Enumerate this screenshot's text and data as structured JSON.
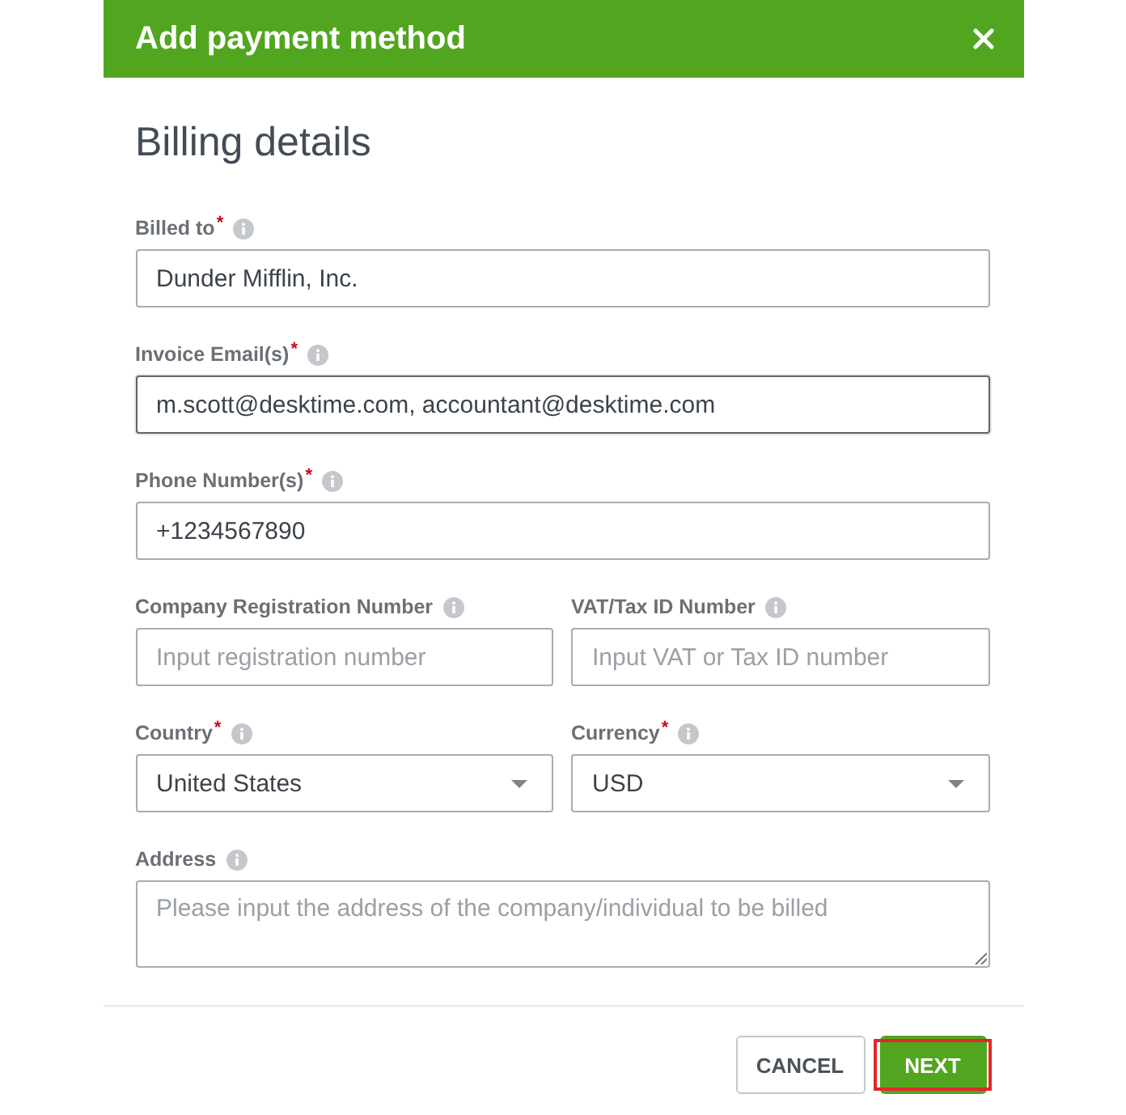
{
  "dialog": {
    "title": "Add payment method",
    "heading": "Billing details"
  },
  "rows": [
    {
      "fields": [
        {
          "kind": "text",
          "label": "Billed to",
          "required_mark": "*",
          "info": true,
          "value": "Dunder Mifflin, Inc.",
          "focused": false
        }
      ]
    },
    {
      "fields": [
        {
          "kind": "text",
          "label": "Invoice Email(s)",
          "required_mark": "*",
          "info": true,
          "value": "m.scott@desktime.com, accountant@desktime.com",
          "focused": true
        }
      ]
    },
    {
      "fields": [
        {
          "kind": "text",
          "label": "Phone Number(s)",
          "required_mark": "*",
          "info": true,
          "value": "+1234567890",
          "focused": false
        }
      ]
    },
    {
      "fields": [
        {
          "kind": "text",
          "label": "Company Registration Number",
          "info": true,
          "placeholder": "Input registration number",
          "focused": false
        },
        {
          "kind": "text",
          "label": "VAT/Tax ID Number",
          "info": true,
          "placeholder": "Input VAT or Tax ID number",
          "focused": false
        }
      ]
    },
    {
      "fields": [
        {
          "kind": "select",
          "label": "Country",
          "required_mark": "*",
          "info": true,
          "value": "United States",
          "focused": false
        },
        {
          "kind": "select",
          "label": "Currency",
          "required_mark": "*",
          "info": true,
          "value": "USD",
          "focused": false
        }
      ]
    },
    {
      "fields": [
        {
          "kind": "textarea",
          "label": "Address",
          "info": true,
          "placeholder": "Please input the address of the company/individual to be billed",
          "focused": false
        }
      ]
    }
  ],
  "buttons": [
    {
      "kind": "secondary",
      "label": "CANCEL",
      "highlighted": false
    },
    {
      "kind": "primary",
      "label": "NEXT",
      "highlighted": true
    }
  ]
}
